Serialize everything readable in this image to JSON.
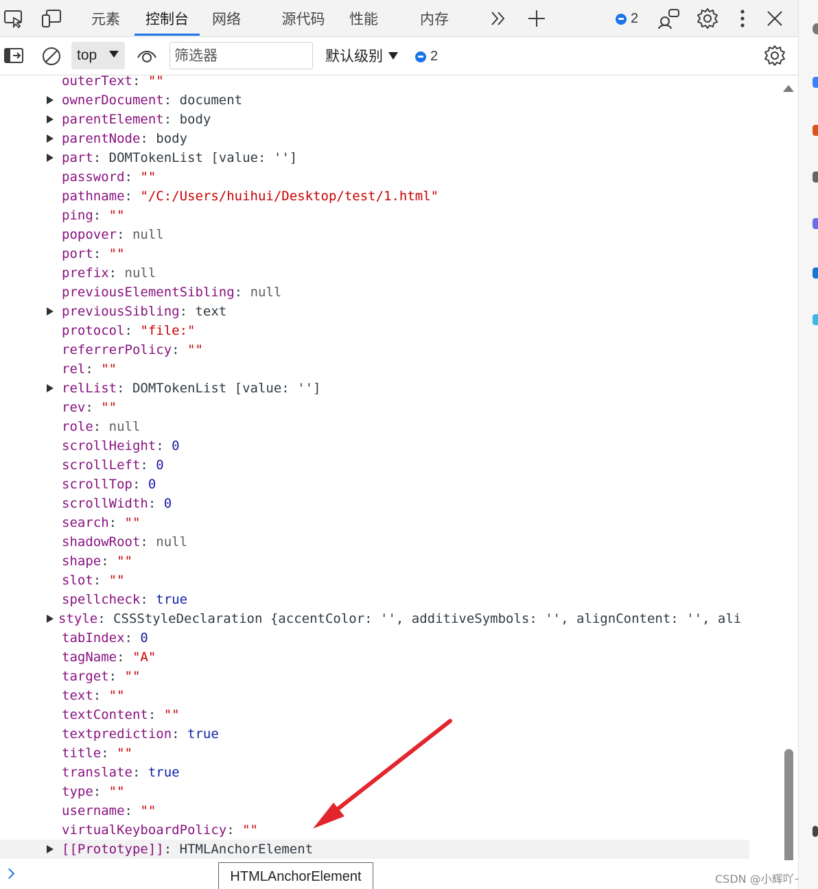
{
  "tabbar": {
    "tabs": [
      "元素",
      "控制台",
      "网络",
      "源代码",
      "性能",
      "内存"
    ],
    "active_tab": "控制台",
    "message_count": "2"
  },
  "toolbar": {
    "context": "top",
    "filter_placeholder": "筛选器",
    "level": "默认级别",
    "message_count": "2"
  },
  "properties": [
    {
      "key": "outerText",
      "value": "\"\"",
      "kind": "str",
      "expandable": false
    },
    {
      "key": "ownerDocument",
      "value": "document",
      "kind": "tag",
      "expandable": true
    },
    {
      "key": "parentElement",
      "value": "body",
      "kind": "tag",
      "expandable": true
    },
    {
      "key": "parentNode",
      "value": "body",
      "kind": "tag",
      "expandable": true
    },
    {
      "key": "part",
      "value": "DOMTokenList [value: '']",
      "kind": "obj",
      "expandable": true
    },
    {
      "key": "password",
      "value": "\"\"",
      "kind": "str",
      "expandable": false
    },
    {
      "key": "pathname",
      "value": "\"/C:/Users/huihui/Desktop/test/1.html\"",
      "kind": "str",
      "expandable": false
    },
    {
      "key": "ping",
      "value": "\"\"",
      "kind": "str",
      "expandable": false
    },
    {
      "key": "popover",
      "value": "null",
      "kind": "null",
      "expandable": false
    },
    {
      "key": "port",
      "value": "\"\"",
      "kind": "str",
      "expandable": false
    },
    {
      "key": "prefix",
      "value": "null",
      "kind": "null",
      "expandable": false
    },
    {
      "key": "previousElementSibling",
      "value": "null",
      "kind": "null",
      "expandable": false
    },
    {
      "key": "previousSibling",
      "value": "text",
      "kind": "tag",
      "expandable": true
    },
    {
      "key": "protocol",
      "value": "\"file:\"",
      "kind": "str",
      "expandable": false
    },
    {
      "key": "referrerPolicy",
      "value": "\"\"",
      "kind": "str",
      "expandable": false
    },
    {
      "key": "rel",
      "value": "\"\"",
      "kind": "str",
      "expandable": false
    },
    {
      "key": "relList",
      "value": "DOMTokenList [value: '']",
      "kind": "obj",
      "expandable": true
    },
    {
      "key": "rev",
      "value": "\"\"",
      "kind": "str",
      "expandable": false
    },
    {
      "key": "role",
      "value": "null",
      "kind": "null",
      "expandable": false
    },
    {
      "key": "scrollHeight",
      "value": "0",
      "kind": "num",
      "expandable": false
    },
    {
      "key": "scrollLeft",
      "value": "0",
      "kind": "num",
      "expandable": false
    },
    {
      "key": "scrollTop",
      "value": "0",
      "kind": "num",
      "expandable": false
    },
    {
      "key": "scrollWidth",
      "value": "0",
      "kind": "num",
      "expandable": false
    },
    {
      "key": "search",
      "value": "\"\"",
      "kind": "str",
      "expandable": false
    },
    {
      "key": "shadowRoot",
      "value": "null",
      "kind": "null",
      "expandable": false
    },
    {
      "key": "shape",
      "value": "\"\"",
      "kind": "str",
      "expandable": false
    },
    {
      "key": "slot",
      "value": "\"\"",
      "kind": "str",
      "expandable": false
    },
    {
      "key": "spellcheck",
      "value": "true",
      "kind": "kw",
      "expandable": false
    },
    {
      "key": "style",
      "value": "CSSStyleDeclaration {accentColor: '', additiveSymbols: '', alignContent: '', ali",
      "kind": "obj",
      "expandable": true,
      "outdent": true
    },
    {
      "key": "tabIndex",
      "value": "0",
      "kind": "num",
      "expandable": false
    },
    {
      "key": "tagName",
      "value": "\"A\"",
      "kind": "str",
      "expandable": false
    },
    {
      "key": "target",
      "value": "\"\"",
      "kind": "str",
      "expandable": false
    },
    {
      "key": "text",
      "value": "\"\"",
      "kind": "str",
      "expandable": false
    },
    {
      "key": "textContent",
      "value": "\"\"",
      "kind": "str",
      "expandable": false
    },
    {
      "key": "textprediction",
      "value": "true",
      "kind": "kw",
      "expandable": false
    },
    {
      "key": "title",
      "value": "\"\"",
      "kind": "str",
      "expandable": false
    },
    {
      "key": "translate",
      "value": "true",
      "kind": "kw",
      "expandable": false
    },
    {
      "key": "type",
      "value": "\"\"",
      "kind": "str",
      "expandable": false
    },
    {
      "key": "username",
      "value": "\"\"",
      "kind": "str",
      "expandable": false
    },
    {
      "key": "virtualKeyboardPolicy",
      "value": "\"\"",
      "kind": "str",
      "expandable": false
    },
    {
      "key": "[[Prototype]]",
      "value": "HTMLAnchorElement",
      "kind": "proto",
      "expandable": true,
      "highlight": true
    }
  ],
  "tooltip": "HTMLAnchorElement",
  "watermark": "CSDN @小辉吖~",
  "colors": {
    "accent": "#1a73e8",
    "key": "#881280",
    "string": "#c80000",
    "keyword": "#0d22aa",
    "arrow": "#e3262e"
  }
}
